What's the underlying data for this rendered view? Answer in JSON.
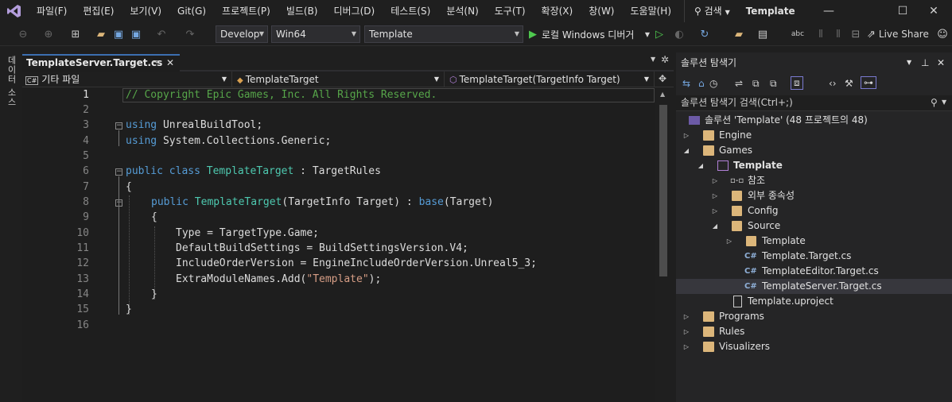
{
  "menu": {
    "items": [
      "파일(F)",
      "편집(E)",
      "보기(V)",
      "Git(G)",
      "프로젝트(P)",
      "빌드(B)",
      "디버그(D)",
      "테스트(S)",
      "분석(N)",
      "도구(T)",
      "확장(X)",
      "창(W)",
      "도움말(H)"
    ],
    "search": "검색",
    "solution_title": "Template"
  },
  "toolbar": {
    "config": "Develop",
    "platform": "Win64",
    "startup": "Template",
    "run": "로컬 Windows 디버거",
    "live_share": "Live Share"
  },
  "left_tab": "데이터 소스",
  "editor": {
    "tab_title": "TemplateServer.Target.cs",
    "nav_project": "기타 파일",
    "nav_class": "TemplateTarget",
    "nav_member": "TemplateTarget(TargetInfo Target)",
    "line_numbers": [
      "1",
      "2",
      "3",
      "4",
      "5",
      "6",
      "7",
      "8",
      "9",
      "10",
      "11",
      "12",
      "13",
      "14",
      "15",
      "16"
    ]
  },
  "code": {
    "l1": "// Copyright Epic Games, Inc. All Rights Reserved.",
    "using": "using",
    "l3b": " UnrealBuildTool;",
    "l4b": " System.Collections.Generic;",
    "public": "public",
    "class": " class ",
    "TemplateTarget": "TemplateTarget",
    "l6c": " : TargetRules",
    "brace_open": "{",
    "brace_close": "}",
    "ctor": "TemplateTarget",
    "l8c": "(TargetInfo Target) : ",
    "base": "base",
    "l8e": "(Target)",
    "l10": "Type = TargetType.Game;",
    "l11": "DefaultBuildSettings = BuildSettingsVersion.V4;",
    "l12": "IncludeOrderVersion = EngineIncludeOrderVersion.Unreal5_3;",
    "l13a": "ExtraModuleNames.Add(",
    "l13s": "\"Template\"",
    "l13c": ");"
  },
  "solution_explorer": {
    "title": "솔루션 탐색기",
    "search_placeholder": "솔루션 탐색기 검색(Ctrl+;)",
    "root": "솔루션 'Template'  (48 프로젝트의 48)",
    "items": [
      "Engine",
      "Games",
      "Template",
      "참조",
      "외부 종속성",
      "Config",
      "Source",
      "Template",
      "Template.Target.cs",
      "TemplateEditor.Target.cs",
      "TemplateServer.Target.cs",
      "Template.uproject",
      "Programs",
      "Rules",
      "Visualizers"
    ]
  },
  "colors": {
    "accent": "#3c6fb0",
    "keyword": "#569cd6",
    "type": "#4ec9b0",
    "comment": "#57a64a",
    "string": "#d69d85"
  }
}
